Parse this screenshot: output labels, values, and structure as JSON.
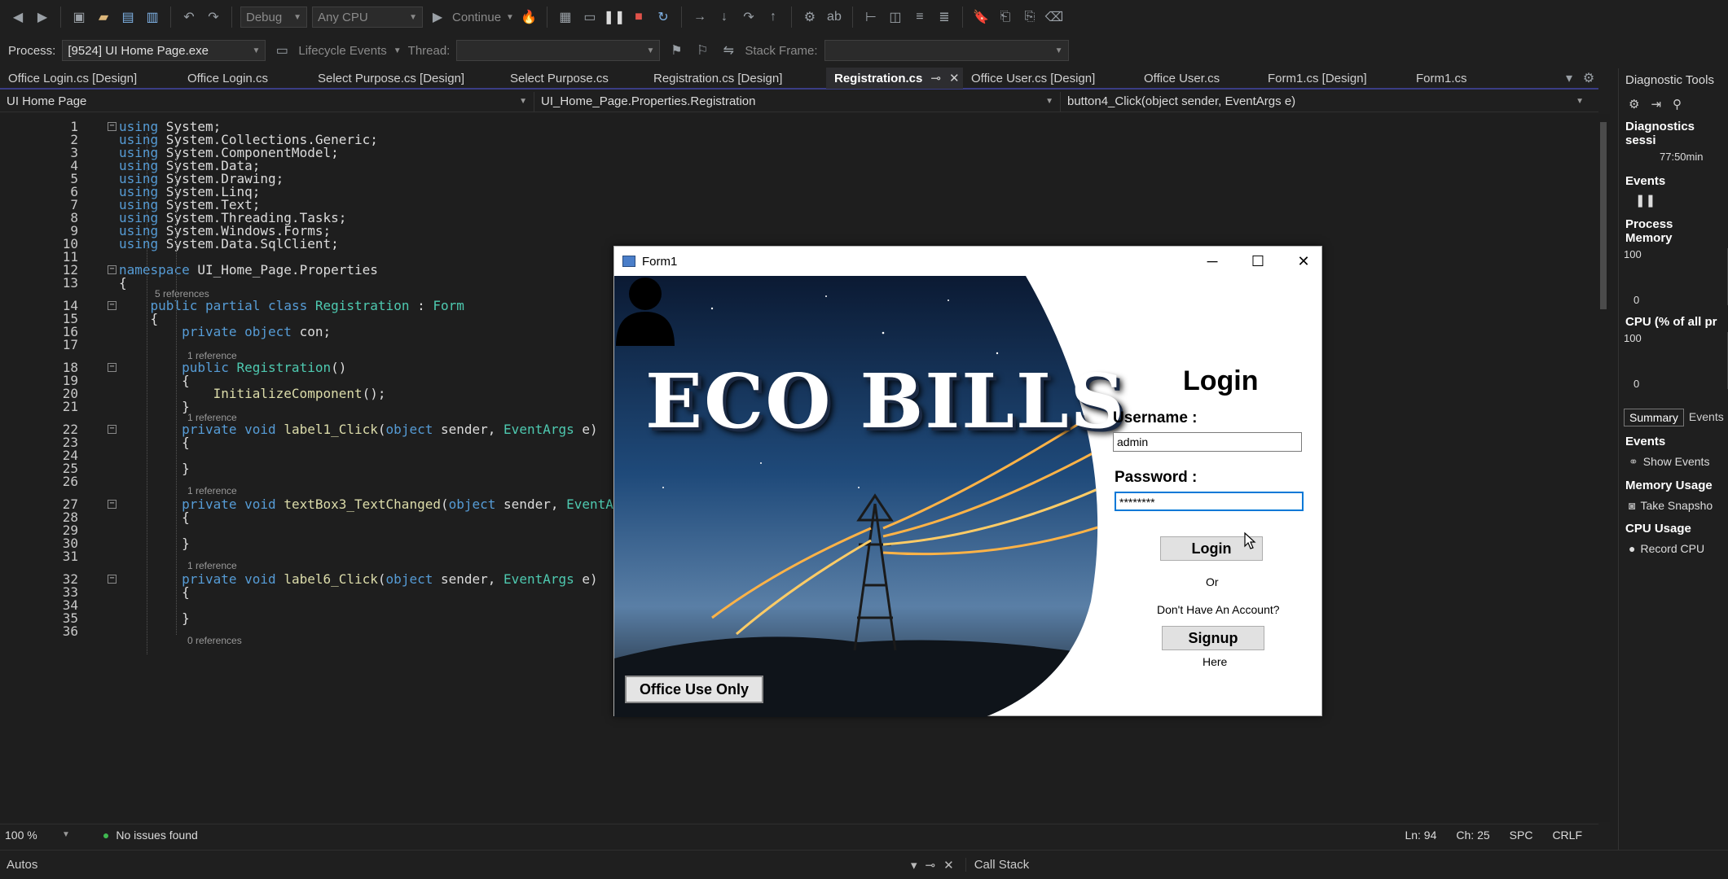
{
  "toolbar": {
    "configuration": "Debug",
    "platform": "Any CPU",
    "continue_label": "Continue",
    "process_label": "Process:",
    "process_value": "[9524] UI Home Page.exe",
    "lifecycle_label": "Lifecycle Events",
    "thread_label": "Thread:",
    "stack_label": "Stack Frame:"
  },
  "tabs": [
    {
      "label": "Office Login.cs [Design]"
    },
    {
      "label": "Office Login.cs"
    },
    {
      "label": "Select Purpose.cs [Design]"
    },
    {
      "label": "Select Purpose.cs"
    },
    {
      "label": "Registration.cs [Design]"
    },
    {
      "label": "Registration.cs",
      "active": true
    },
    {
      "label": "Office User.cs [Design]"
    },
    {
      "label": "Office User.cs"
    },
    {
      "label": "Form1.cs [Design]"
    },
    {
      "label": "Form1.cs"
    }
  ],
  "navbar": {
    "project": "UI Home Page",
    "class": "UI_Home_Page.Properties.Registration",
    "member": "button4_Click(object sender, EventArgs e)"
  },
  "code": {
    "line_numbers": [
      "1",
      "2",
      "3",
      "4",
      "5",
      "6",
      "7",
      "8",
      "9",
      "10",
      "11",
      "12",
      "13",
      "14",
      "15",
      "16",
      "17",
      "18",
      "19",
      "20",
      "21",
      "22",
      "23",
      "24",
      "25",
      "26",
      "27",
      "28",
      "29",
      "30",
      "31",
      "32",
      "33",
      "34",
      "35",
      "36"
    ],
    "refs": {
      "r5": "5 references",
      "r1": "1 reference",
      "r0": "0 references"
    }
  },
  "status": {
    "zoom": "100 %",
    "issues": "No issues found",
    "line": "Ln: 94",
    "col": "Ch: 25",
    "spc": "SPC",
    "crlf": "CRLF"
  },
  "bottom": {
    "autos": "Autos",
    "callstack": "Call Stack"
  },
  "diag": {
    "title": "Diagnostic Tools",
    "session": "Diagnostics sessi",
    "time": "77:50min",
    "events": "Events",
    "process_memory": "Process Memory",
    "mem_max": "100",
    "mem_min": "0",
    "cpu": "CPU (% of all pr",
    "cpu_max": "100",
    "cpu_min": "0",
    "tab_summary": "Summary",
    "tab_events": "Events",
    "events_hdr": "Events",
    "show_events": "Show Events",
    "memory_usage": "Memory Usage",
    "take_snapshot": "Take Snapsho",
    "cpu_usage": "CPU Usage",
    "record_cpu": "Record CPU"
  },
  "form1": {
    "title": "Form1",
    "hero_title": "ECO BILLS",
    "office_btn": "Office Use Only",
    "login_title": "Login",
    "username_label": "Username :",
    "username_value": "admin",
    "password_label": "Password :",
    "password_value": "********",
    "login_btn": "Login",
    "or": "Or",
    "no_account": "Don't Have An Account?",
    "signup_btn": "Signup",
    "here": "Here"
  },
  "colors": {
    "keyword": "#569cd6",
    "type": "#4ec9b0",
    "method": "#dcdcaa",
    "accent": "#3a3d85"
  }
}
